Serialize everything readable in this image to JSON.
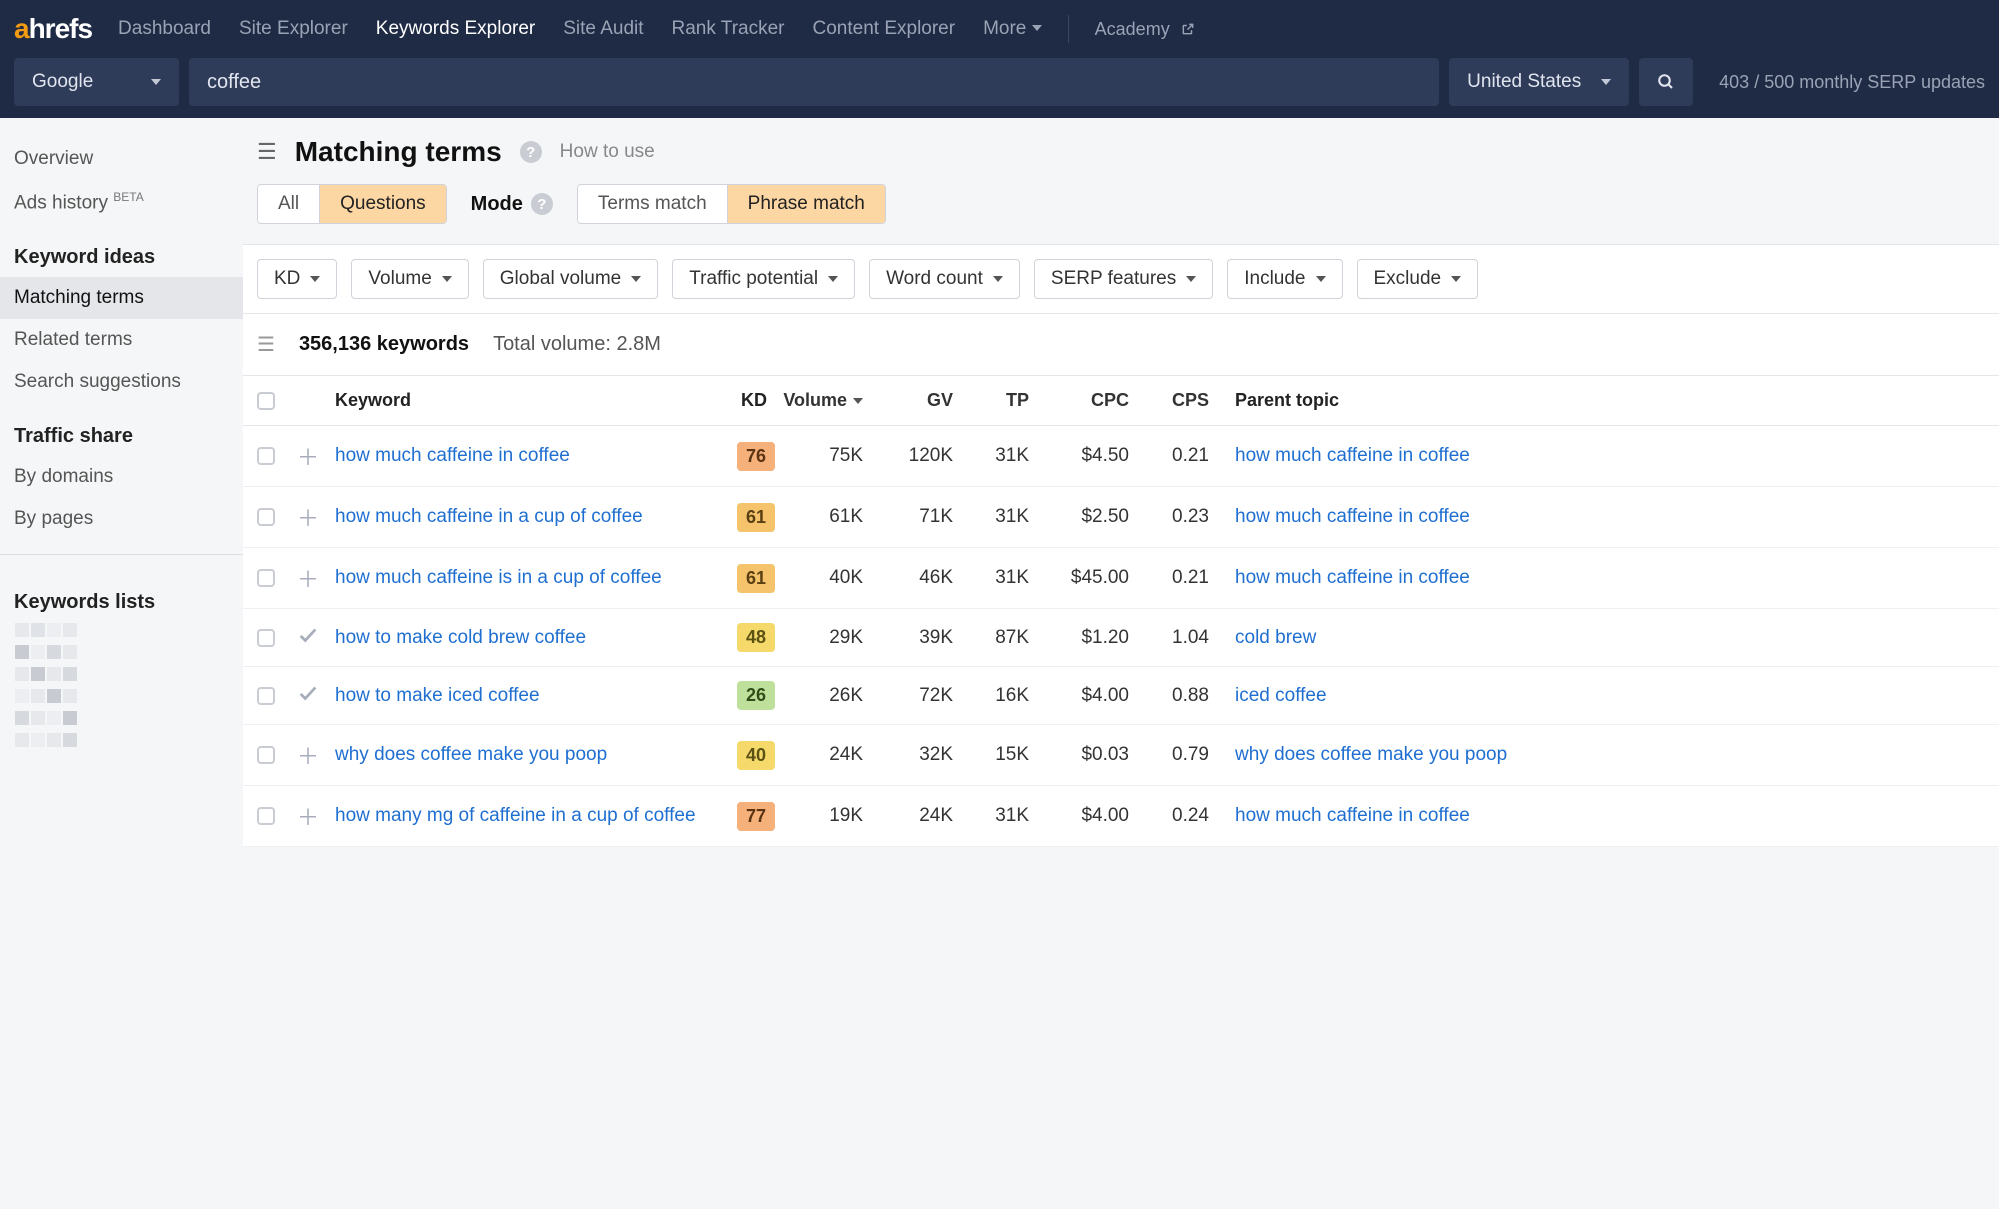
{
  "nav": {
    "logo_prefix": "a",
    "logo_rest": "hrefs",
    "items": [
      "Dashboard",
      "Site Explorer",
      "Keywords Explorer",
      "Site Audit",
      "Rank Tracker",
      "Content Explorer",
      "More"
    ],
    "active_index": 2,
    "academy": "Academy"
  },
  "searchbar": {
    "engine": "Google",
    "query": "coffee",
    "country": "United States",
    "serp_updates": "403 / 500 monthly SERP updates"
  },
  "sidebar": {
    "g0": [
      "Overview",
      "Ads history"
    ],
    "ads_beta": "BETA",
    "h1": "Keyword ideas",
    "g1": [
      "Matching terms",
      "Related terms",
      "Search suggestions"
    ],
    "g1_active_index": 0,
    "h2": "Traffic share",
    "g2": [
      "By domains",
      "By pages"
    ],
    "h3": "Keywords lists"
  },
  "page": {
    "title": "Matching terms",
    "howto": "How to use",
    "tabs_filter": [
      "All",
      "Questions"
    ],
    "tabs_filter_active": 1,
    "mode_label": "Mode",
    "tabs_mode": [
      "Terms match",
      "Phrase match"
    ],
    "tabs_mode_active": 1
  },
  "filters": [
    "KD",
    "Volume",
    "Global volume",
    "Traffic potential",
    "Word count",
    "SERP features",
    "Include",
    "Exclude"
  ],
  "summary": {
    "keywords": "356,136 keywords",
    "total_volume": "Total volume: 2.8M"
  },
  "columns": [
    "Keyword",
    "KD",
    "Volume",
    "GV",
    "TP",
    "CPC",
    "CPS",
    "Parent topic"
  ],
  "rows": [
    {
      "check": false,
      "kw": "how much caffeine in coffee",
      "kd": 76,
      "kd_cls": "kd-hard",
      "vol": "75K",
      "gv": "120K",
      "tp": "31K",
      "cpc": "$4.50",
      "cps": "0.21",
      "parent": "how much caffeine in coffee"
    },
    {
      "check": false,
      "kw": "how much caffeine in a cup of coffee",
      "kd": 61,
      "kd_cls": "kd-med",
      "vol": "61K",
      "gv": "71K",
      "tp": "31K",
      "cpc": "$2.50",
      "cps": "0.23",
      "parent": "how much caffeine in coffee"
    },
    {
      "check": false,
      "kw": "how much caffeine is in a cup of coffee",
      "kd": 61,
      "kd_cls": "kd-med",
      "vol": "40K",
      "gv": "46K",
      "tp": "31K",
      "cpc": "$45.00",
      "cps": "0.21",
      "parent": "how much caffeine in coffee"
    },
    {
      "check": true,
      "kw": "how to make cold brew coffee",
      "kd": 48,
      "kd_cls": "kd-midlow",
      "vol": "29K",
      "gv": "39K",
      "tp": "87K",
      "cpc": "$1.20",
      "cps": "1.04",
      "parent": "cold brew"
    },
    {
      "check": true,
      "kw": "how to make iced coffee",
      "kd": 26,
      "kd_cls": "kd-low",
      "vol": "26K",
      "gv": "72K",
      "tp": "16K",
      "cpc": "$4.00",
      "cps": "0.88",
      "parent": "iced coffee"
    },
    {
      "check": false,
      "kw": "why does coffee make you poop",
      "kd": 40,
      "kd_cls": "kd-midlow",
      "vol": "24K",
      "gv": "32K",
      "tp": "15K",
      "cpc": "$0.03",
      "cps": "0.79",
      "parent": "why does coffee make you poop"
    },
    {
      "check": false,
      "kw": "how many mg of caffeine in a cup of coffee",
      "kd": 77,
      "kd_cls": "kd-hard",
      "vol": "19K",
      "gv": "24K",
      "tp": "31K",
      "cpc": "$4.00",
      "cps": "0.24",
      "parent": "how much caffeine in coffee"
    }
  ]
}
